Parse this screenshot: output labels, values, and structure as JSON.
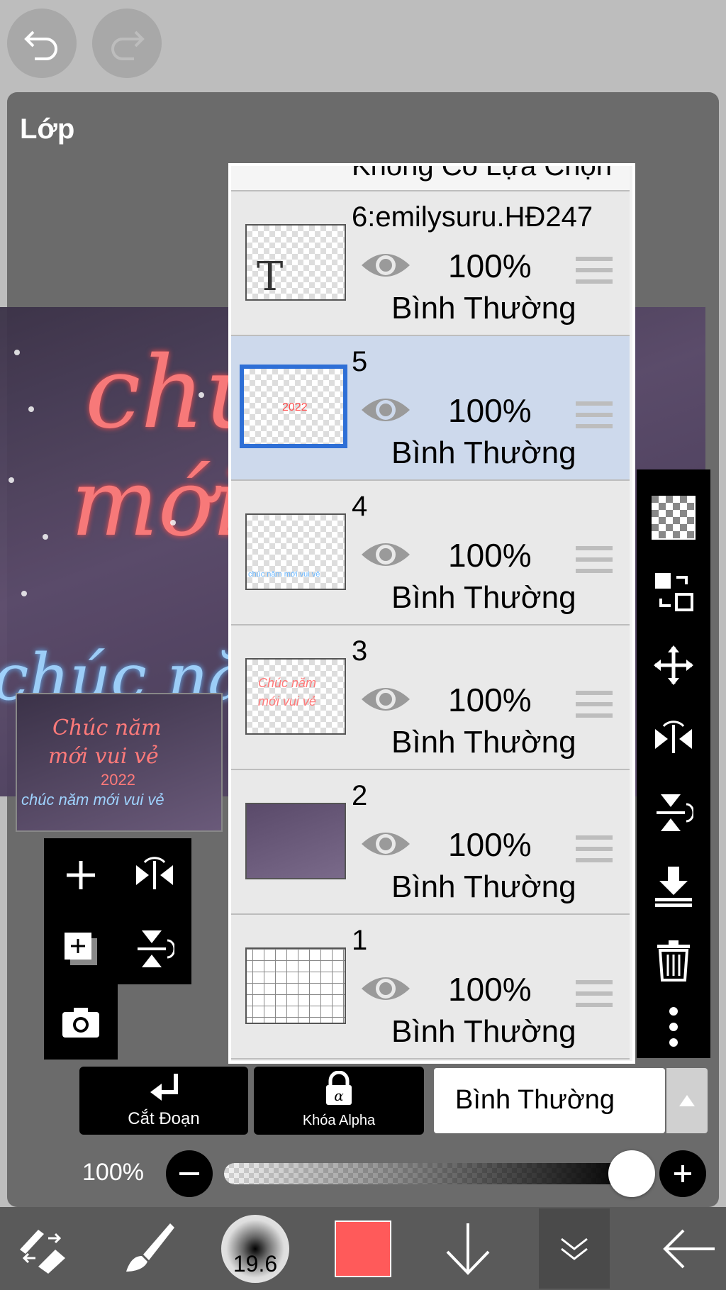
{
  "toolbar_top": {
    "undo_icon": "undo-icon",
    "redo_icon": "redo-icon"
  },
  "panel": {
    "title": "Lớp"
  },
  "canvas": {
    "neon_line1": "chú",
    "neon_line2": "mới",
    "blue_text": "chúc nă"
  },
  "thumbnail": {
    "line1": "Chúc năm",
    "line2": "mới vui vẻ",
    "line3": "2022",
    "line4": "chúc năm mới vui vẻ"
  },
  "layers": {
    "header_partial": "Không Có Lựa Chọn",
    "items": [
      {
        "name": "6:emilysuru.HĐ247",
        "opacity": "100%",
        "mode": "Bình Thường",
        "thumb_text": "T",
        "selected": false
      },
      {
        "name": "5",
        "opacity": "100%",
        "mode": "Bình Thường",
        "thumb_text": "2022",
        "selected": true
      },
      {
        "name": "4",
        "opacity": "100%",
        "mode": "Bình Thường",
        "thumb_text": "chúc năm mới vui vẻ",
        "selected": false
      },
      {
        "name": "3",
        "opacity": "100%",
        "mode": "Bình Thường",
        "thumb_text": "Chúc năm mới vui vẻ",
        "selected": false
      },
      {
        "name": "2",
        "opacity": "100%",
        "mode": "Bình Thường",
        "thumb_text": "",
        "selected": false
      },
      {
        "name": "1",
        "opacity": "100%",
        "mode": "Bình Thường",
        "thumb_text": "",
        "selected": false
      }
    ]
  },
  "bottom_buttons": {
    "clip_label": "Cắt Đoạn",
    "alpha_lock_label": "Khóa Alpha",
    "blend_mode": "Bình Thường"
  },
  "opacity": {
    "label": "100%",
    "level": 1.0
  },
  "brush": {
    "size": "19.6"
  },
  "colors": {
    "current_color": "#ff5a5a",
    "selection_accent": "#2e6fd6",
    "selected_row": "#cdd9ec"
  }
}
